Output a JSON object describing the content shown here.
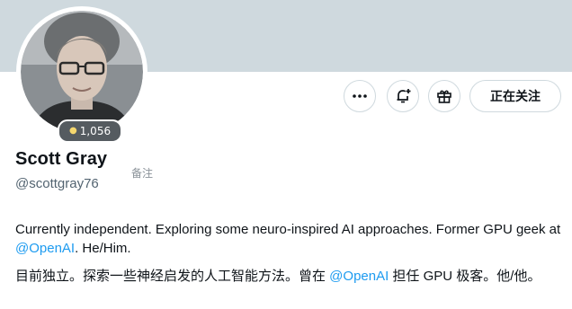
{
  "profile": {
    "badge_count": "1,056",
    "name": "Scott Gray",
    "note_label": "备注",
    "handle": "@scottgray76",
    "follow_label": "正在关注"
  },
  "actions": {
    "more_icon": "more-horizontal-icon",
    "notify_icon": "bell-plus-icon",
    "subscribe_icon": "gift-icon"
  },
  "bio_en": {
    "text_1": "Currently independent.  Exploring some neuro-inspired AI approaches.  Former GPU geek at ",
    "mention": "@OpenAI",
    "text_2": ".  He/Him."
  },
  "bio_zh": {
    "text_1": "目前独立。探索一些神经启发的人工智能方法。曾在 ",
    "mention": "@OpenAI",
    "text_2": " 担任 GPU 极客。他/他。"
  },
  "colors": {
    "banner": "#cfd9de",
    "link": "#1d9bf0",
    "text": "#0f1419",
    "muted": "#536471"
  }
}
